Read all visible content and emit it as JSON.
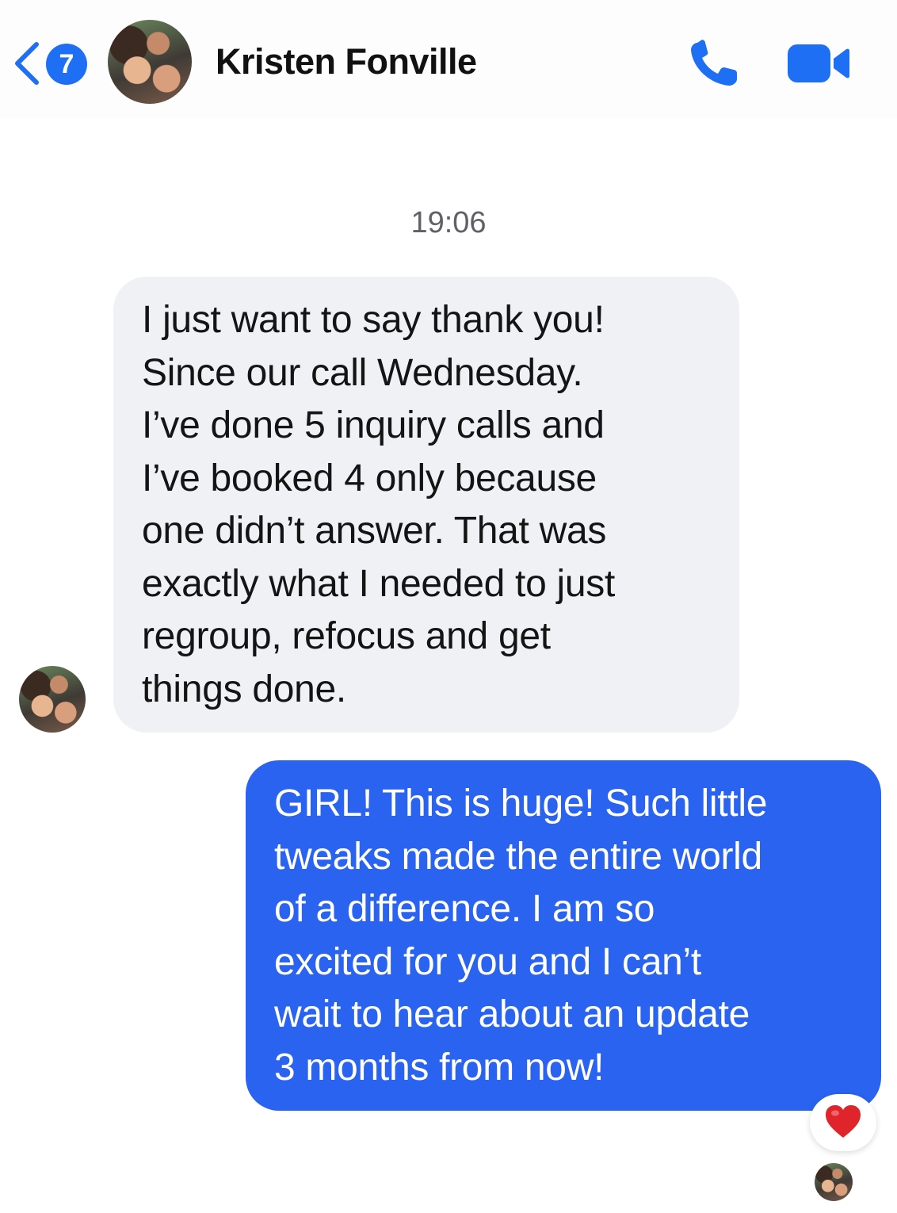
{
  "header": {
    "back_badge": "7",
    "contact_name": "Kristen Fonville",
    "call_icon": "phone-icon",
    "video_icon": "video-camera-icon"
  },
  "conversation": {
    "timestamp": "19:06",
    "messages": [
      {
        "direction": "received",
        "text": "I just want to say thank you!\nSince our call Wednesday.\nI’ve done 5 inquiry calls and\nI’ve booked 4 only because\none didn’t answer. That was\nexactly what I needed to just\nregroup, refocus and get\nthings done."
      },
      {
        "direction": "sent",
        "text": "GIRL! This is huge! Such little\ntweaks made the entire world\nof a difference. I am so\nexcited for you and I can’t\nwait to hear about an update\n3 months from now!",
        "reaction": "heart-icon"
      }
    ]
  },
  "colors": {
    "accent": "#1f6ff5",
    "sent_bubble": "#2a63f0",
    "received_bubble": "#f0f1f4",
    "reaction_heart": "#e0242b"
  }
}
